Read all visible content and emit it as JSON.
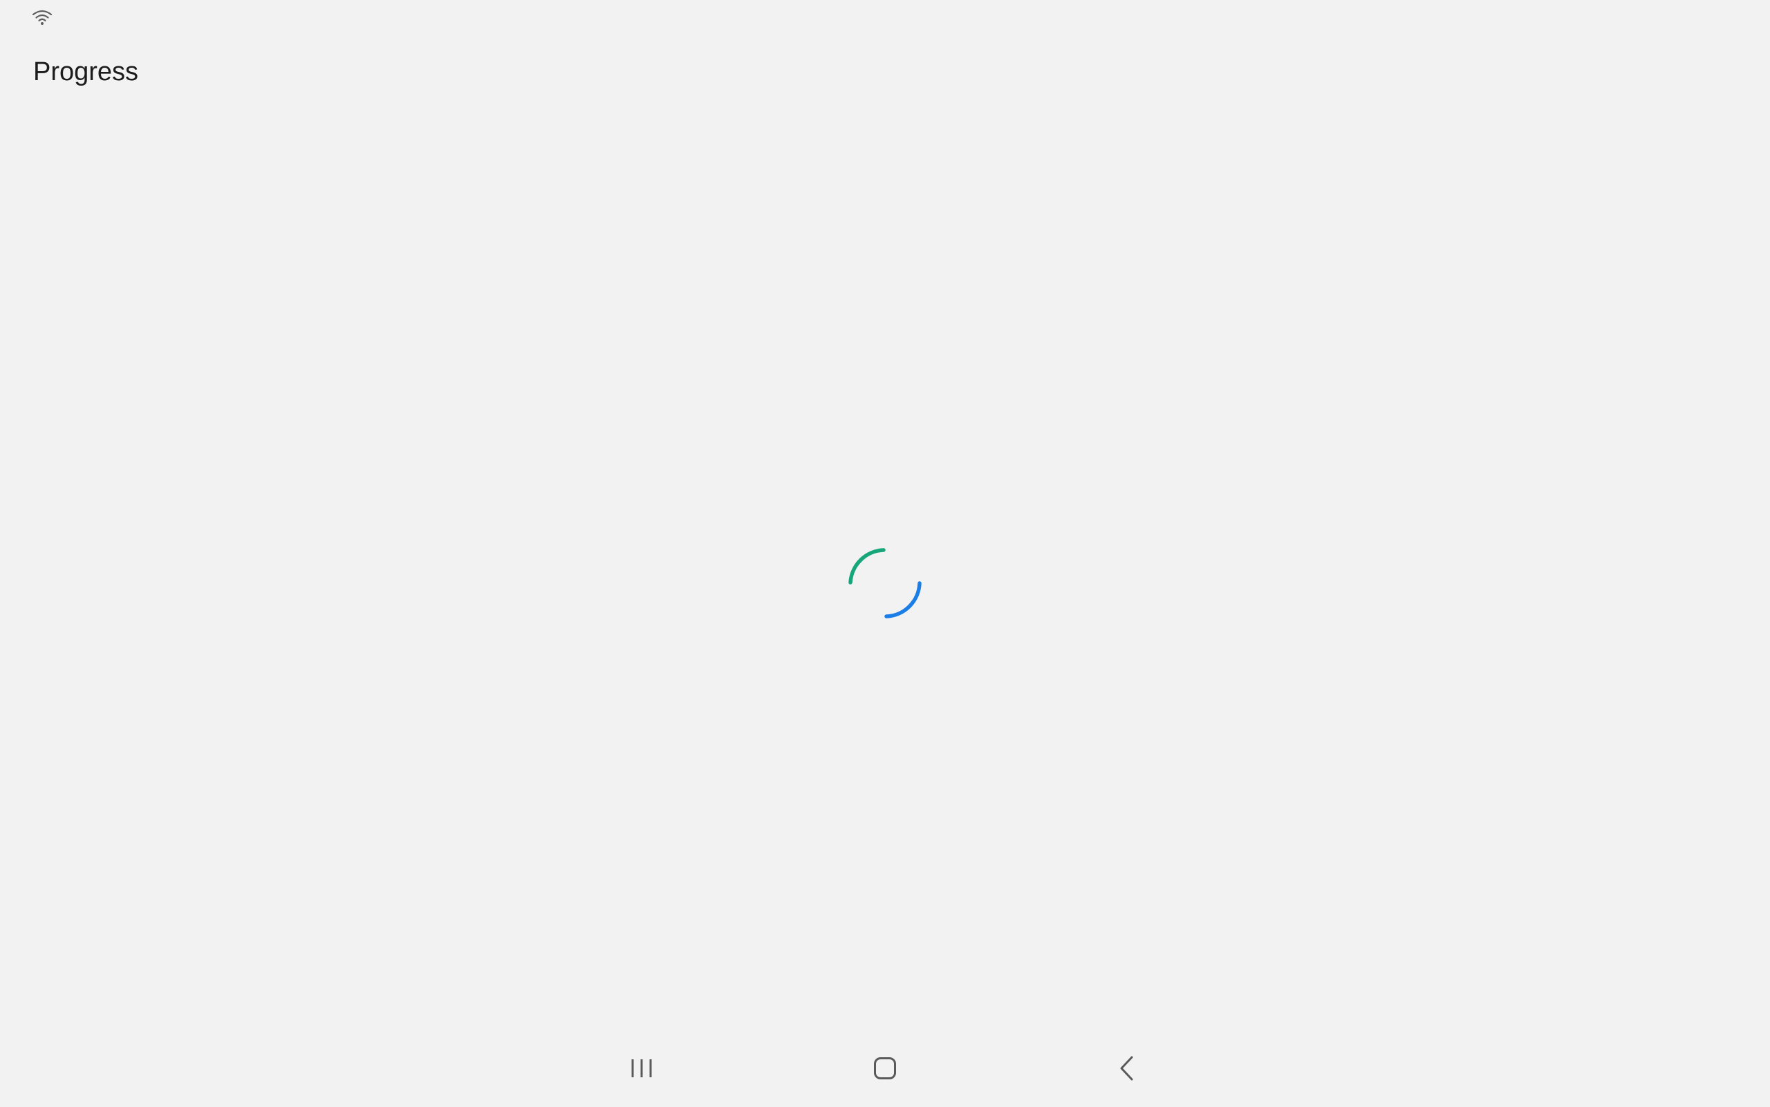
{
  "status_bar": {
    "wifi_icon": "wifi-icon"
  },
  "header": {
    "title": "Progress"
  },
  "loading_indicator": {
    "type": "indeterminate-circular-spinner",
    "colors": {
      "arc_top_left": "#17a67a",
      "arc_bottom_right": "#1a7ee6"
    }
  },
  "navigation_bar": {
    "buttons": [
      {
        "icon": "recents-icon"
      },
      {
        "icon": "home-icon"
      },
      {
        "icon": "back-icon"
      }
    ],
    "icon_color": "#5a5a5a"
  },
  "colors": {
    "background": "#f2f2f2",
    "text": "#1c1c1c"
  }
}
